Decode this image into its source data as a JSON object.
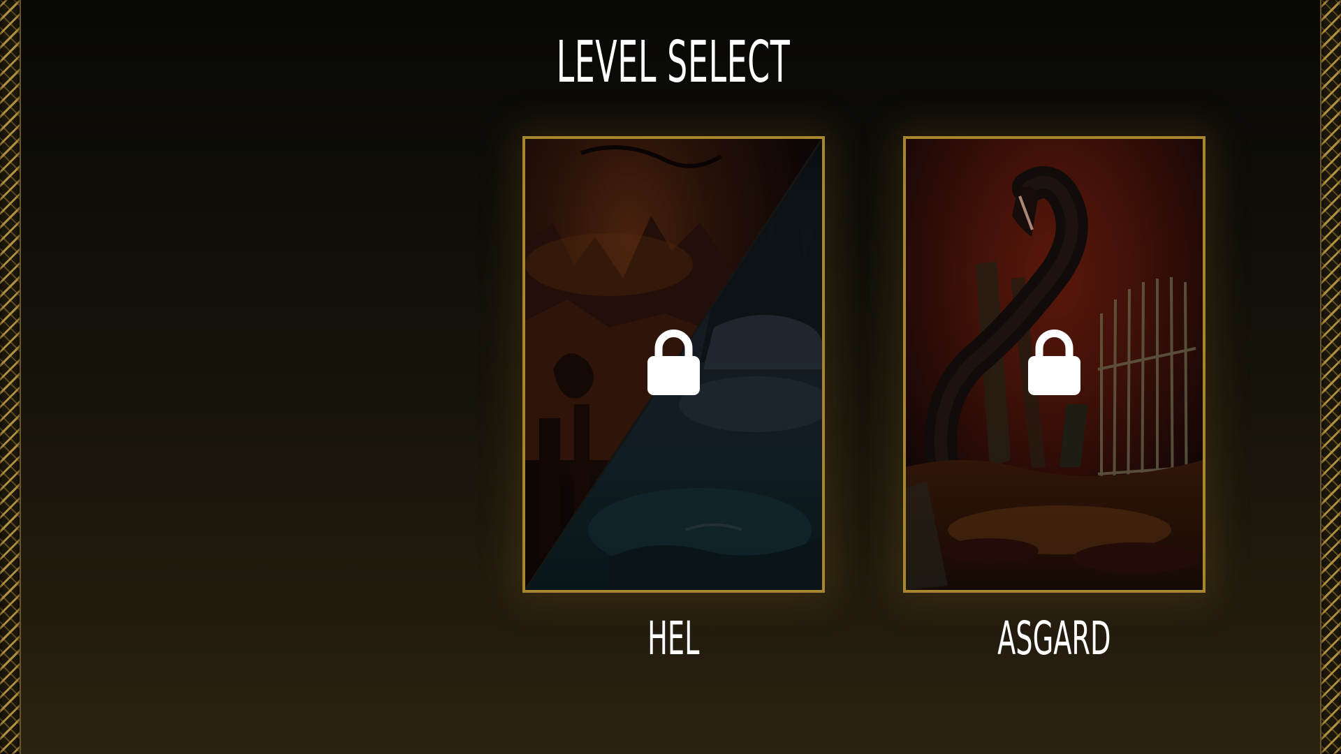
{
  "screen": {
    "title": "LEVEL SELECT"
  },
  "levels": [
    {
      "name": "HEL",
      "locked": true,
      "art": "split-realm-lava-and-ice"
    },
    {
      "name": "ASGARD",
      "locked": true,
      "art": "serpent-and-broken-gate"
    }
  ],
  "icons": {
    "lock": "lock-icon",
    "border": "chain-border-pattern"
  },
  "colors": {
    "frame_gold": "#a8852f",
    "border_gold": "#b99641",
    "text": "#ffffff",
    "background_top": "#080806",
    "background_bottom": "#2a2212"
  }
}
